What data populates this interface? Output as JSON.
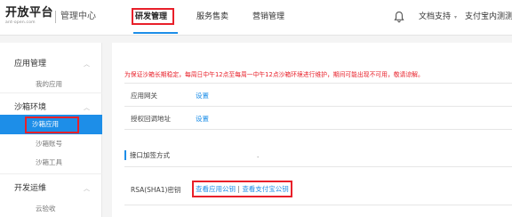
{
  "brand": {
    "title": "开放平台",
    "subtitle": "ant-open.com",
    "console": "管理中心"
  },
  "nav": {
    "tabs": [
      "研发管理",
      "服务售卖",
      "营销管理"
    ],
    "active": "研发管理"
  },
  "header_right": {
    "docs": "文档支持",
    "account": "支付宝内测测"
  },
  "sidebar": {
    "groups": [
      {
        "label": "应用管理",
        "items": [
          "我的应用"
        ]
      },
      {
        "label": "沙箱环境",
        "items": [
          "沙箱应用",
          "沙箱账号",
          "沙箱工具"
        ]
      },
      {
        "label": "开发运维",
        "items": [
          "云验收"
        ]
      }
    ],
    "active_item": "沙箱应用"
  },
  "main": {
    "notice": "为保证沙箱长期稳定，每周日中午12点至每周一中午12点沙箱环境进行维护，期间可能出现不可用，敬请谅解。",
    "rows": [
      {
        "label": "应用网关",
        "link": "设置"
      },
      {
        "label": "授权回调地址",
        "link": "设置"
      }
    ],
    "section_title": "接口加签方式",
    "section_dot": ".",
    "key_row": {
      "label": "RSA(SHA1)密钥",
      "link1": "查看应用公钥",
      "separator": "|",
      "link2": "查看支付宝公钥"
    }
  },
  "colors": {
    "accent": "#1d8ee8",
    "highlight": "#e8202a",
    "notice": "#e8202a"
  },
  "icons": {
    "bell": "bell-icon",
    "caret": "chevron-down-icon",
    "group_chevron": "chevron-up-icon"
  }
}
